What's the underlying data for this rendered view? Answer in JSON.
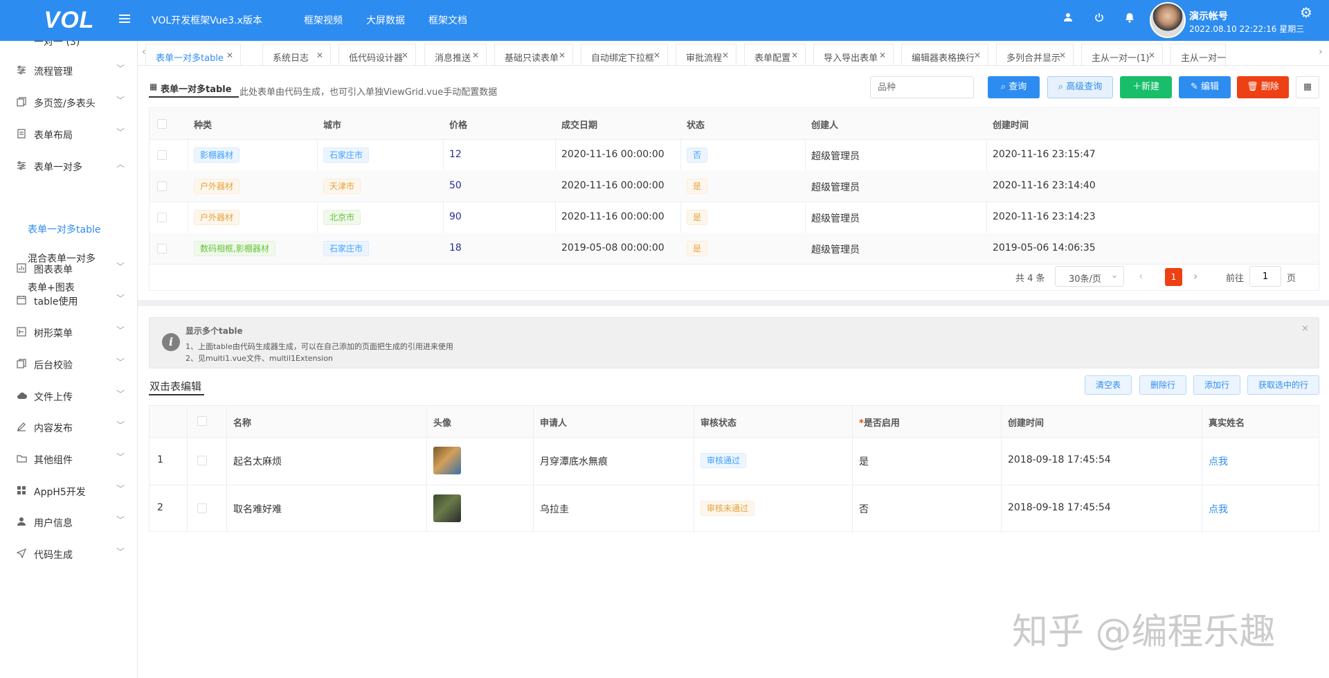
{
  "header": {
    "logo": "VOL",
    "app_title": "VOL开发框架Vue3.x版本",
    "nav": [
      "框架视频",
      "大屏数据",
      "框架文档"
    ],
    "username": "演示帐号",
    "login_time": "2022.08.10 22:22:16 星期三"
  },
  "sidebar": {
    "top_partial": "一对一 (3)",
    "items": [
      {
        "label": "流程管理",
        "icon": "sliders-icon"
      },
      {
        "label": "多页签/多表头",
        "icon": "copy-icon"
      },
      {
        "label": "表单布局",
        "icon": "document-icon"
      },
      {
        "label": "表单一对多",
        "icon": "sliders-icon"
      },
      {
        "label": "图表表单",
        "icon": "chart-icon"
      },
      {
        "label": "table使用",
        "icon": "calendar-icon"
      },
      {
        "label": "树形菜单",
        "icon": "tree-icon"
      },
      {
        "label": "后台校验",
        "icon": "copy-icon"
      },
      {
        "label": "文件上传",
        "icon": "cloud-upload-icon"
      },
      {
        "label": "内容发布",
        "icon": "pen-icon"
      },
      {
        "label": "其他组件",
        "icon": "folder-icon"
      },
      {
        "label": "AppH5开发",
        "icon": "grid-icon"
      },
      {
        "label": "用户信息",
        "icon": "user-icon"
      },
      {
        "label": "代码生成",
        "icon": "send-icon"
      }
    ],
    "subitems": [
      "表单一对多table",
      "混合表单一对多",
      "表单+图表"
    ],
    "active_sub": "表单一对多table"
  },
  "tabs": [
    "表单一对多table",
    "系统日志",
    "低代码设计器",
    "消息推送",
    "基础只读表单",
    "自动绑定下拉框",
    "审批流程",
    "表单配置",
    "导入导出表单",
    "编辑器表格换行",
    "多列合并显示",
    "主从一对一(1)",
    "主从一对一"
  ],
  "main": {
    "title": "表单一对多table",
    "description": "此处表单由代码生成，也可引入单独ViewGrid.vue手动配置数据",
    "search_placeholder": "品种",
    "buttons": {
      "query": "查询",
      "advanced": "高级查询",
      "add": "新建",
      "edit": "编辑",
      "delete": "删除"
    },
    "columns": [
      "种类",
      "城市",
      "价格",
      "成交日期",
      "状态",
      "创建人",
      "创建时间"
    ],
    "rows": [
      {
        "kind": "影棚器材",
        "city": "石家庄市",
        "price": "12",
        "date": "2020-11-16 00:00:00",
        "status": "否",
        "creator": "超级管理员",
        "created": "2020-11-16 23:15:47"
      },
      {
        "kind": "户外器材",
        "city": "天津市",
        "price": "50",
        "date": "2020-11-16 00:00:00",
        "status": "是",
        "creator": "超级管理员",
        "created": "2020-11-16 23:14:40"
      },
      {
        "kind": "户外器材",
        "city": "北京市",
        "price": "90",
        "date": "2020-11-16 00:00:00",
        "status": "是",
        "creator": "超级管理员",
        "created": "2020-11-16 23:14:23"
      },
      {
        "kind": "数码相框,影棚器材",
        "city": "石家庄市",
        "price": "18",
        "date": "2019-05-08 00:00:00",
        "status": "是",
        "creator": "超级管理员",
        "created": "2019-05-06 14:06:35"
      }
    ],
    "pager": {
      "total": "共 4 条",
      "page_size": "30条/页",
      "current": "1",
      "goto_label": "前往",
      "goto_value": "1",
      "page_unit": "页"
    }
  },
  "alert": {
    "title": "显示多个table",
    "lines": [
      "1、上面table由代码生成器生成，可以在自己添加的页面把生成的引用进来使用",
      "2、见multi1.vue文件、multil1Extension"
    ]
  },
  "edit": {
    "title": "双击表编辑",
    "buttons": [
      "清空表",
      "删除行",
      "添加行",
      "获取选中的行"
    ],
    "columns": [
      "名称",
      "头像",
      "申请人",
      "审核状态",
      "是否启用",
      "创建时间",
      "真实姓名"
    ],
    "required_mark": "*",
    "rows": [
      {
        "no": "1",
        "name": "起名太麻烦",
        "applicant": "月穿潭底水無痕",
        "audit": "审核通过",
        "enabled": "是",
        "created": "2018-09-18 17:45:54",
        "realname": "点我"
      },
      {
        "no": "2",
        "name": "取名难好难",
        "applicant": "乌拉圭",
        "audit": "审核未通过",
        "enabled": "否",
        "created": "2018-09-18 17:45:54",
        "realname": "点我"
      }
    ]
  },
  "watermark": "知乎 @编程乐趣",
  "colors": {
    "primary": "#2d8cf0",
    "success": "#19be6b",
    "danger": "#ed4014",
    "header": "#2d8cf0"
  }
}
